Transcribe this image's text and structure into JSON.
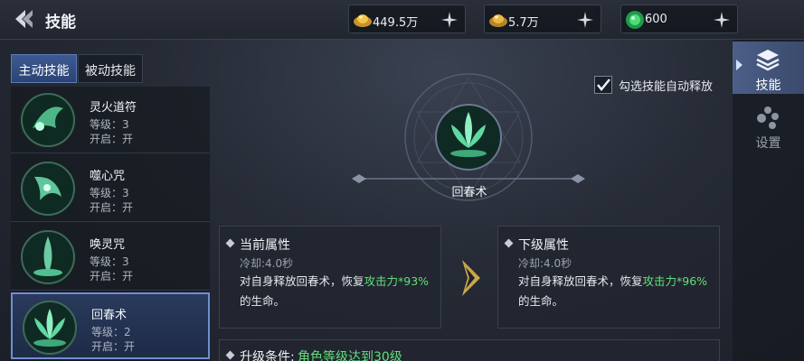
{
  "header": {
    "title": "技能",
    "currencies": [
      {
        "icon": "gold-ingot-icon",
        "value": "449.5万"
      },
      {
        "icon": "silver-ingot-icon",
        "value": "5.7万"
      },
      {
        "icon": "jade-gem-icon",
        "value": "600"
      }
    ]
  },
  "tabs": [
    {
      "label": "主动技能",
      "active": true
    },
    {
      "label": "被动技能",
      "active": false
    }
  ],
  "skills": [
    {
      "name": "灵火道符",
      "level": "等级：3",
      "open": "开启：开"
    },
    {
      "name": "噬心咒",
      "level": "等级：3",
      "open": "开启：开"
    },
    {
      "name": "唤灵咒",
      "level": "等级：3",
      "open": "开启：开"
    },
    {
      "name": "回春术",
      "level": "等级：2",
      "open": "开启：开",
      "selected": true
    }
  ],
  "auto_release": {
    "label": "勾选技能自动释放",
    "checked": true
  },
  "selected_skill": {
    "name": "回春术"
  },
  "current": {
    "title": "当前属性",
    "cooldown": "冷却:4.0秒",
    "desc_prefix": "对自身释放回春术，恢复",
    "desc_highlight": "攻击力*93%",
    "desc_suffix": "的生命。"
  },
  "next": {
    "title": "下级属性",
    "cooldown": "冷却:4.0秒",
    "desc_prefix": "对自身释放回春术，恢复",
    "desc_highlight": "攻击力*96%",
    "desc_suffix": "的生命。"
  },
  "upgrade": {
    "label": "升级条件:",
    "value": "角色等级达到30级"
  },
  "side_nav": [
    {
      "label": "技能",
      "icon": "skill-stack-icon",
      "active": true
    },
    {
      "label": "设置",
      "icon": "settings-dots-icon",
      "active": false
    }
  ],
  "colors": {
    "highlight": "#5fe07a",
    "accent": "#3c5a93"
  }
}
